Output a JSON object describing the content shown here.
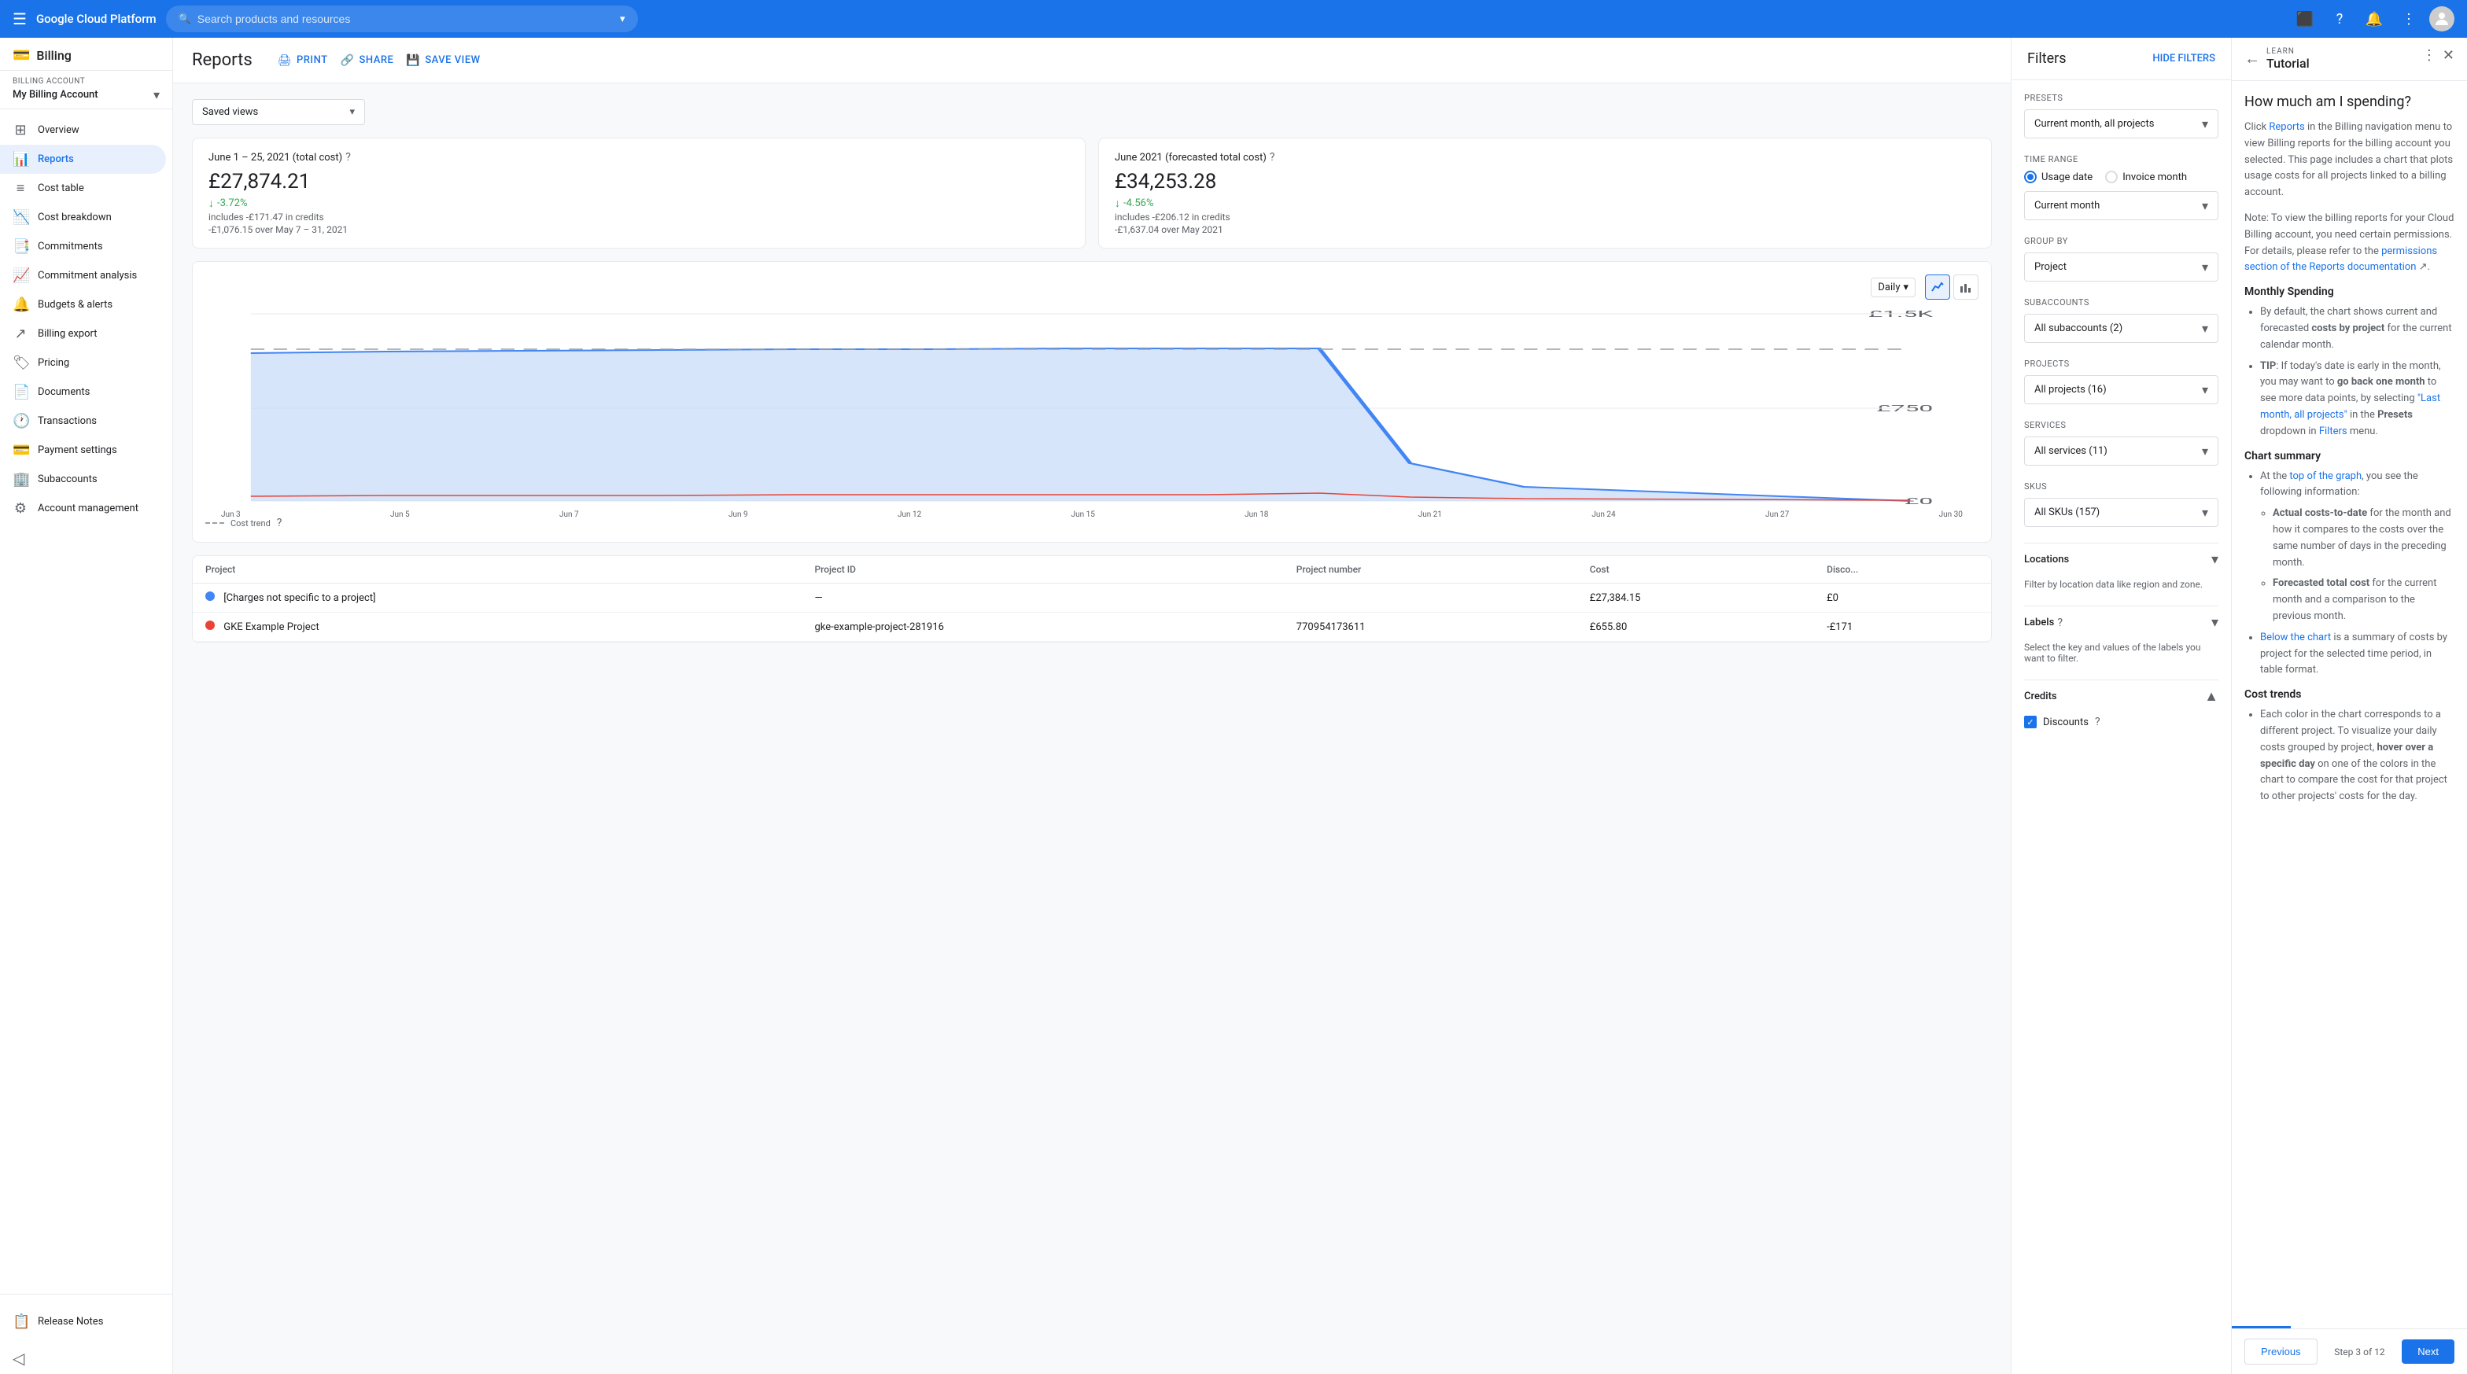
{
  "topnav": {
    "logo": "Google Cloud Platform",
    "search_placeholder": "Search products and resources"
  },
  "sidebar": {
    "billing_title": "Billing",
    "account_label": "Billing account",
    "account_name": "My Billing Account",
    "items": [
      {
        "id": "overview",
        "label": "Overview",
        "icon": "⊞"
      },
      {
        "id": "reports",
        "label": "Reports",
        "icon": "📊",
        "active": true
      },
      {
        "id": "cost-table",
        "label": "Cost table",
        "icon": "📋"
      },
      {
        "id": "cost-breakdown",
        "label": "Cost breakdown",
        "icon": "📉"
      },
      {
        "id": "commitments",
        "label": "Commitments",
        "icon": "📑"
      },
      {
        "id": "commitment-analysis",
        "label": "Commitment analysis",
        "icon": "📈"
      },
      {
        "id": "budgets-alerts",
        "label": "Budgets & alerts",
        "icon": "🔔"
      },
      {
        "id": "billing-export",
        "label": "Billing export",
        "icon": "↗"
      },
      {
        "id": "pricing",
        "label": "Pricing",
        "icon": "🏷"
      },
      {
        "id": "documents",
        "label": "Documents",
        "icon": "📄"
      },
      {
        "id": "transactions",
        "label": "Transactions",
        "icon": "🕐"
      },
      {
        "id": "payment-settings",
        "label": "Payment settings",
        "icon": "💳"
      },
      {
        "id": "subaccounts",
        "label": "Subaccounts",
        "icon": "🏢"
      },
      {
        "id": "account-management",
        "label": "Account management",
        "icon": "⚙"
      }
    ],
    "release_notes": "Release Notes",
    "collapse_icon": "◁"
  },
  "reports": {
    "title": "Reports",
    "actions": {
      "print": "PRINT",
      "share": "SHARE",
      "save_view": "SAVE VIEW"
    },
    "saved_views_label": "Saved views",
    "stat1": {
      "title": "June 1 – 25, 2021 (total cost)",
      "amount": "£27,874.21",
      "change": "-3.72%",
      "detail1": "includes -£171.47 in credits",
      "detail2": "-£1,076.15 over May 7 – 31, 2021"
    },
    "stat2": {
      "title": "June 2021 (forecasted total cost)",
      "amount": "£34,253.28",
      "change": "-4.56%",
      "detail1": "includes -£206.12 in credits",
      "detail2": "-£1,637.04 over May 2021"
    },
    "chart": {
      "period_label": "Daily",
      "y_max": "£1.5K",
      "y_mid": "£750",
      "y_min": "£0",
      "x_labels": [
        "Jun 3",
        "Jun 5",
        "Jun 7",
        "Jun 9",
        "Jun 12",
        "Jun 15",
        "Jun 18",
        "Jun 21",
        "Jun 24",
        "Jun 27",
        "Jun 30"
      ],
      "legend_cost_trend": "Cost trend"
    },
    "table": {
      "columns": [
        "Project",
        "Project ID",
        "Project number",
        "Cost",
        "Discounts"
      ],
      "rows": [
        {
          "name": "[Charges not specific to a project]",
          "id": "—",
          "number": "",
          "cost": "£27,384.15",
          "discount": "£0",
          "color": "#4285f4"
        },
        {
          "name": "GKE Example Project",
          "id": "gke-example-project-281916",
          "number": "770954173611",
          "cost": "£655.80",
          "discount": "-£171",
          "color": "#ea4335"
        }
      ]
    }
  },
  "filters": {
    "title": "Filters",
    "hide_label": "HIDE FILTERS",
    "presets_label": "Presets",
    "presets_value": "Current month, all projects",
    "time_range_label": "Time range",
    "time_range_options": [
      "Usage date",
      "Invoice month"
    ],
    "time_range_selected": "Usage date",
    "current_month_label": "Current month",
    "group_by_label": "Group by",
    "group_by_value": "Project",
    "subaccounts_label": "Subaccounts",
    "subaccounts_value": "All subaccounts (2)",
    "projects_label": "Projects",
    "projects_value": "All projects (16)",
    "services_label": "Services",
    "services_value": "All services (11)",
    "skus_label": "SKUs",
    "skus_value": "All SKUs (157)",
    "locations_label": "Locations",
    "locations_desc": "Filter by location data like region and zone.",
    "labels_label": "Labels",
    "labels_desc": "Select the key and values of the labels you want to filter.",
    "credits_label": "Credits",
    "discounts_label": "Discounts",
    "discounts_checked": true
  },
  "tutorial": {
    "back_icon": "←",
    "learn_label": "LEARN",
    "title": "Tutorial",
    "close_icon": "✕",
    "menu_icon": "⋮",
    "section_title": "How much am I spending?",
    "intro": "Click Reports in the Billing navigation menu to view Billing reports for the billing account you selected. This page includes a chart that plots usage costs for all projects linked to a billing account.",
    "note": "Note: To view the billing reports for your Cloud Billing account, you need certain permissions. For details, please refer to the permissions section of the Reports documentation.",
    "monthly_spending_title": "Monthly Spending",
    "monthly_spending_items": [
      "By default, the chart shows current and forecasted costs by project for the current calendar month.",
      "TIP: If today's date is early in the month, you may want to go back one month to see more data points, by selecting \"Last month, all projects\" in the Presets dropdown in Filters menu."
    ],
    "chart_summary_title": "Chart summary",
    "chart_summary_items": [
      "At the top of the graph, you see the following information:",
      "Actual costs-to-date for the month and how it compares to the costs over the same number of days in the preceding month.",
      "Forecasted total cost for the current month and a comparison to the previous month.",
      "Below the chart is a summary of costs by project for the selected time period, in table format."
    ],
    "cost_trends_title": "Cost trends",
    "cost_trends_items": [
      "Each color in the chart corresponds to a different project. To visualize your daily costs grouped by project, hover over a specific day on one of the colors in the chart to compare the cost for that project to other projects' costs for the day."
    ],
    "footer": {
      "prev_label": "Previous",
      "step_label": "Step 3 of 12",
      "next_label": "Next"
    }
  }
}
